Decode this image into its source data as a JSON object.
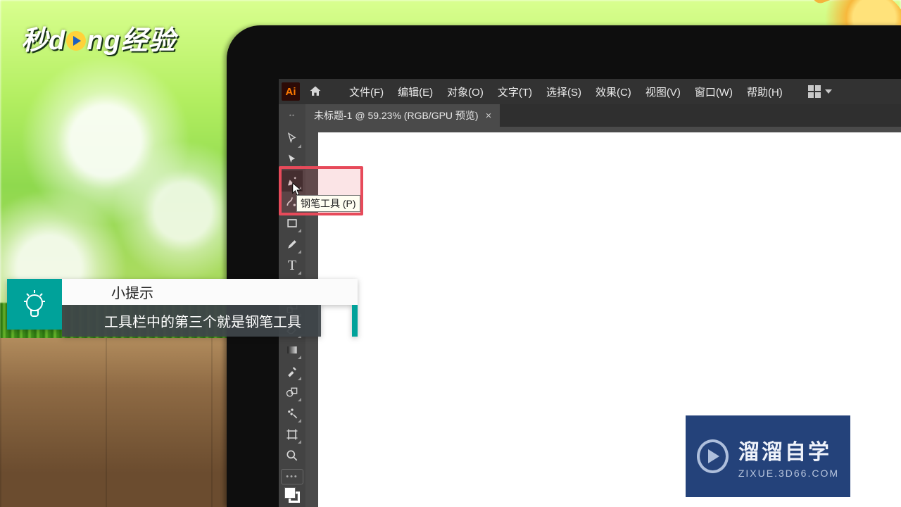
{
  "site_logo_text": "秒d   ng经验",
  "menubar": {
    "app_badge": "Ai",
    "items": [
      {
        "label": "文件(F)"
      },
      {
        "label": "编辑(E)"
      },
      {
        "label": "对象(O)"
      },
      {
        "label": "文字(T)"
      },
      {
        "label": "选择(S)"
      },
      {
        "label": "效果(C)"
      },
      {
        "label": "视图(V)"
      },
      {
        "label": "窗口(W)"
      },
      {
        "label": "帮助(H)"
      }
    ]
  },
  "document_tab": {
    "title": "未标题-1 @ 59.23% (RGB/GPU 预览)",
    "close": "×"
  },
  "tooltip": {
    "text": "钢笔工具 (P)"
  },
  "tip": {
    "heading": "小提示",
    "message": "工具栏中的第三个就是钢笔工具"
  },
  "watermark": {
    "title": "溜溜自学",
    "url": "ZIXUE.3D66.COM"
  },
  "tools": [
    {
      "name": "selection-tool",
      "icon": "arrow"
    },
    {
      "name": "direct-selection-tool",
      "icon": "arrow-solid"
    },
    {
      "name": "pen-tool",
      "icon": "pen",
      "selected": true
    },
    {
      "name": "curvature-tool",
      "icon": "curve"
    },
    {
      "name": "rectangle-tool",
      "icon": "rect"
    },
    {
      "name": "paintbrush-tool",
      "icon": "brush"
    },
    {
      "name": "type-tool",
      "icon": "type"
    },
    {
      "name": "ellipse-aux-tool",
      "icon": "circ"
    },
    {
      "name": "rotate-tool",
      "icon": "rotate"
    },
    {
      "name": "eraser-tool",
      "icon": "eraser"
    },
    {
      "name": "gradient-tool",
      "icon": "grad"
    },
    {
      "name": "eyedropper-tool",
      "icon": "eyedrop"
    },
    {
      "name": "blend-tool",
      "icon": "blend"
    },
    {
      "name": "symbol-sprayer-tool",
      "icon": "spray"
    },
    {
      "name": "artboard-tool",
      "icon": "artboard"
    },
    {
      "name": "zoom-tool",
      "icon": "zoom"
    }
  ]
}
